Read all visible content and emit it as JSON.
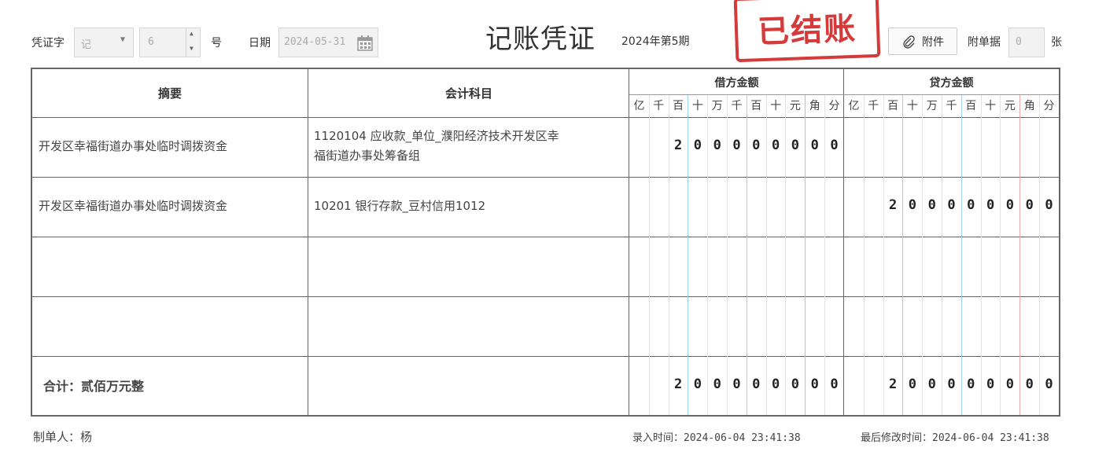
{
  "header": {
    "voucher_word_label": "凭证字",
    "voucher_word_value": "记",
    "voucher_number_value": "6",
    "number_suffix": "号",
    "date_label": "日期",
    "date_value": "2024-05-31",
    "title": "记账凭证",
    "period": "2024年第5期",
    "stamp": "已结账",
    "attachment_button": "附件",
    "attached_docs_label": "附单据",
    "attached_docs_value": "0",
    "attached_docs_unit": "张"
  },
  "table": {
    "col_summary": "摘要",
    "col_account": "会计科目",
    "col_debit": "借方金额",
    "col_credit": "贷方金额",
    "units": [
      "亿",
      "千",
      "百",
      "十",
      "万",
      "千",
      "百",
      "十",
      "元",
      "角",
      "分"
    ],
    "rows": [
      {
        "summary": "开发区幸福街道办事处临时调拨资金",
        "account_line1": "1120104 应收款_单位_濮阳经济技术开发区幸",
        "account_line2": "福街道办事处筹备组",
        "debit_digits": [
          "",
          "",
          "2",
          "0",
          "0",
          "0",
          "0",
          "0",
          "0",
          "0",
          "0"
        ],
        "credit_digits": [
          "",
          "",
          "",
          "",
          "",
          "",
          "",
          "",
          "",
          "",
          ""
        ]
      },
      {
        "summary": "开发区幸福街道办事处临时调拨资金",
        "account_line1": "10201 银行存款_豆村信用1012",
        "account_line2": "",
        "debit_digits": [
          "",
          "",
          "",
          "",
          "",
          "",
          "",
          "",
          "",
          "",
          ""
        ],
        "credit_digits": [
          "",
          "",
          "2",
          "0",
          "0",
          "0",
          "0",
          "0",
          "0",
          "0",
          "0"
        ]
      },
      {
        "summary": "",
        "account_line1": "",
        "account_line2": "",
        "debit_digits": [
          "",
          "",
          "",
          "",
          "",
          "",
          "",
          "",
          "",
          "",
          ""
        ],
        "credit_digits": [
          "",
          "",
          "",
          "",
          "",
          "",
          "",
          "",
          "",
          "",
          ""
        ]
      },
      {
        "summary": "",
        "account_line1": "",
        "account_line2": "",
        "debit_digits": [
          "",
          "",
          "",
          "",
          "",
          "",
          "",
          "",
          "",
          "",
          ""
        ],
        "credit_digits": [
          "",
          "",
          "",
          "",
          "",
          "",
          "",
          "",
          "",
          "",
          ""
        ]
      }
    ],
    "total_label": "合计：贰佰万元整",
    "total_debit_digits": [
      "",
      "",
      "2",
      "0",
      "0",
      "0",
      "0",
      "0",
      "0",
      "0",
      "0"
    ],
    "total_credit_digits": [
      "",
      "",
      "2",
      "0",
      "0",
      "0",
      "0",
      "0",
      "0",
      "0",
      "0"
    ]
  },
  "footer": {
    "preparer": "制单人：杨",
    "entry_time": "录入时间：2024-06-04 23:41:38",
    "modified_time": "最后修改时间：2024-06-04 23:41:38"
  },
  "colors": {
    "stamp": "#d53a3a",
    "border": "#666666",
    "blue_divider": "#9fd3ee",
    "red_divider": "#f0a9a9"
  }
}
